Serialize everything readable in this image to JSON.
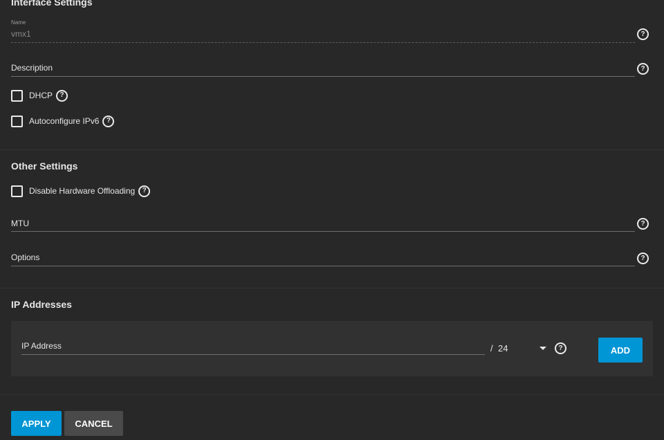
{
  "interface_settings": {
    "title": "Interface Settings",
    "name": {
      "label": "Name",
      "value": "vmx1"
    },
    "description": {
      "label": "Description"
    },
    "dhcp": {
      "label": "DHCP",
      "checked": false
    },
    "autoconfigure_ipv6": {
      "label": "Autoconfigure IPv6",
      "checked": false
    }
  },
  "other_settings": {
    "title": "Other Settings",
    "disable_hw_offloading": {
      "label": "Disable Hardware Offloading",
      "checked": false
    },
    "mtu": {
      "label": "MTU"
    },
    "options": {
      "label": "Options"
    }
  },
  "ip_addresses": {
    "title": "IP Addresses",
    "ip_address": {
      "label": "IP Address"
    },
    "separator": "/",
    "netmask": "24",
    "add_label": "ADD"
  },
  "actions": {
    "apply_label": "APPLY",
    "cancel_label": "CANCEL"
  },
  "colors": {
    "background": "#282828",
    "card": "#313131",
    "primary": "#0095d5",
    "secondary": "#4a4a4a"
  },
  "icons": {
    "help": "help-circle-icon",
    "dropdown": "chevron-down-icon"
  }
}
